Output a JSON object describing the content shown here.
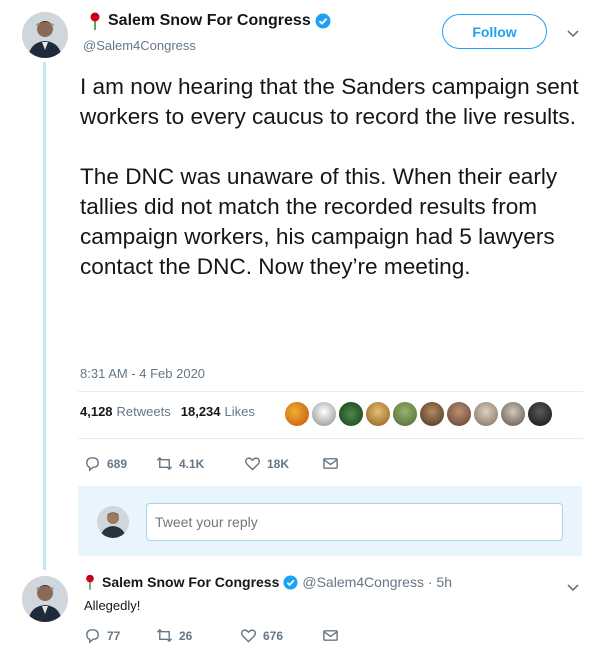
{
  "main_tweet": {
    "display_name": "Salem Snow For Congress",
    "handle": "@Salem4Congress",
    "follow_label": "Follow",
    "text_paragraph_1": "I am now hearing that the Sanders campaign sent workers to every caucus to record the live results.",
    "text_paragraph_2": "The DNC was unaware of this. When their early tallies did not match the recorded results from campaign workers, his campaign had 5 lawyers contact the DNC. Now they’re meeting.",
    "timestamp": "8:31 AM - 4 Feb 2020",
    "retweets_count": "4,128",
    "retweets_label": "Retweets",
    "likes_count": "18,234",
    "likes_label": "Likes",
    "actions": {
      "replies": "689",
      "retweets": "4.1K",
      "likes": "18K"
    }
  },
  "reply_box": {
    "placeholder": "Tweet your reply"
  },
  "reply_tweet": {
    "display_name": "Salem Snow For Congress",
    "handle_time": "@Salem4Congress · 5h",
    "text": "Allegedly!",
    "actions": {
      "replies": "77",
      "retweets": "26",
      "likes": "676"
    }
  },
  "colors": {
    "accent": "#1da1f2",
    "secondary_text": "#657786",
    "thread_line": "#c4e6f7",
    "reply_box_bg": "#e8f5fd"
  },
  "icons": [
    "rose-icon",
    "verified-icon",
    "chevron-down-icon",
    "reply-icon",
    "retweet-icon",
    "heart-icon",
    "message-icon"
  ]
}
